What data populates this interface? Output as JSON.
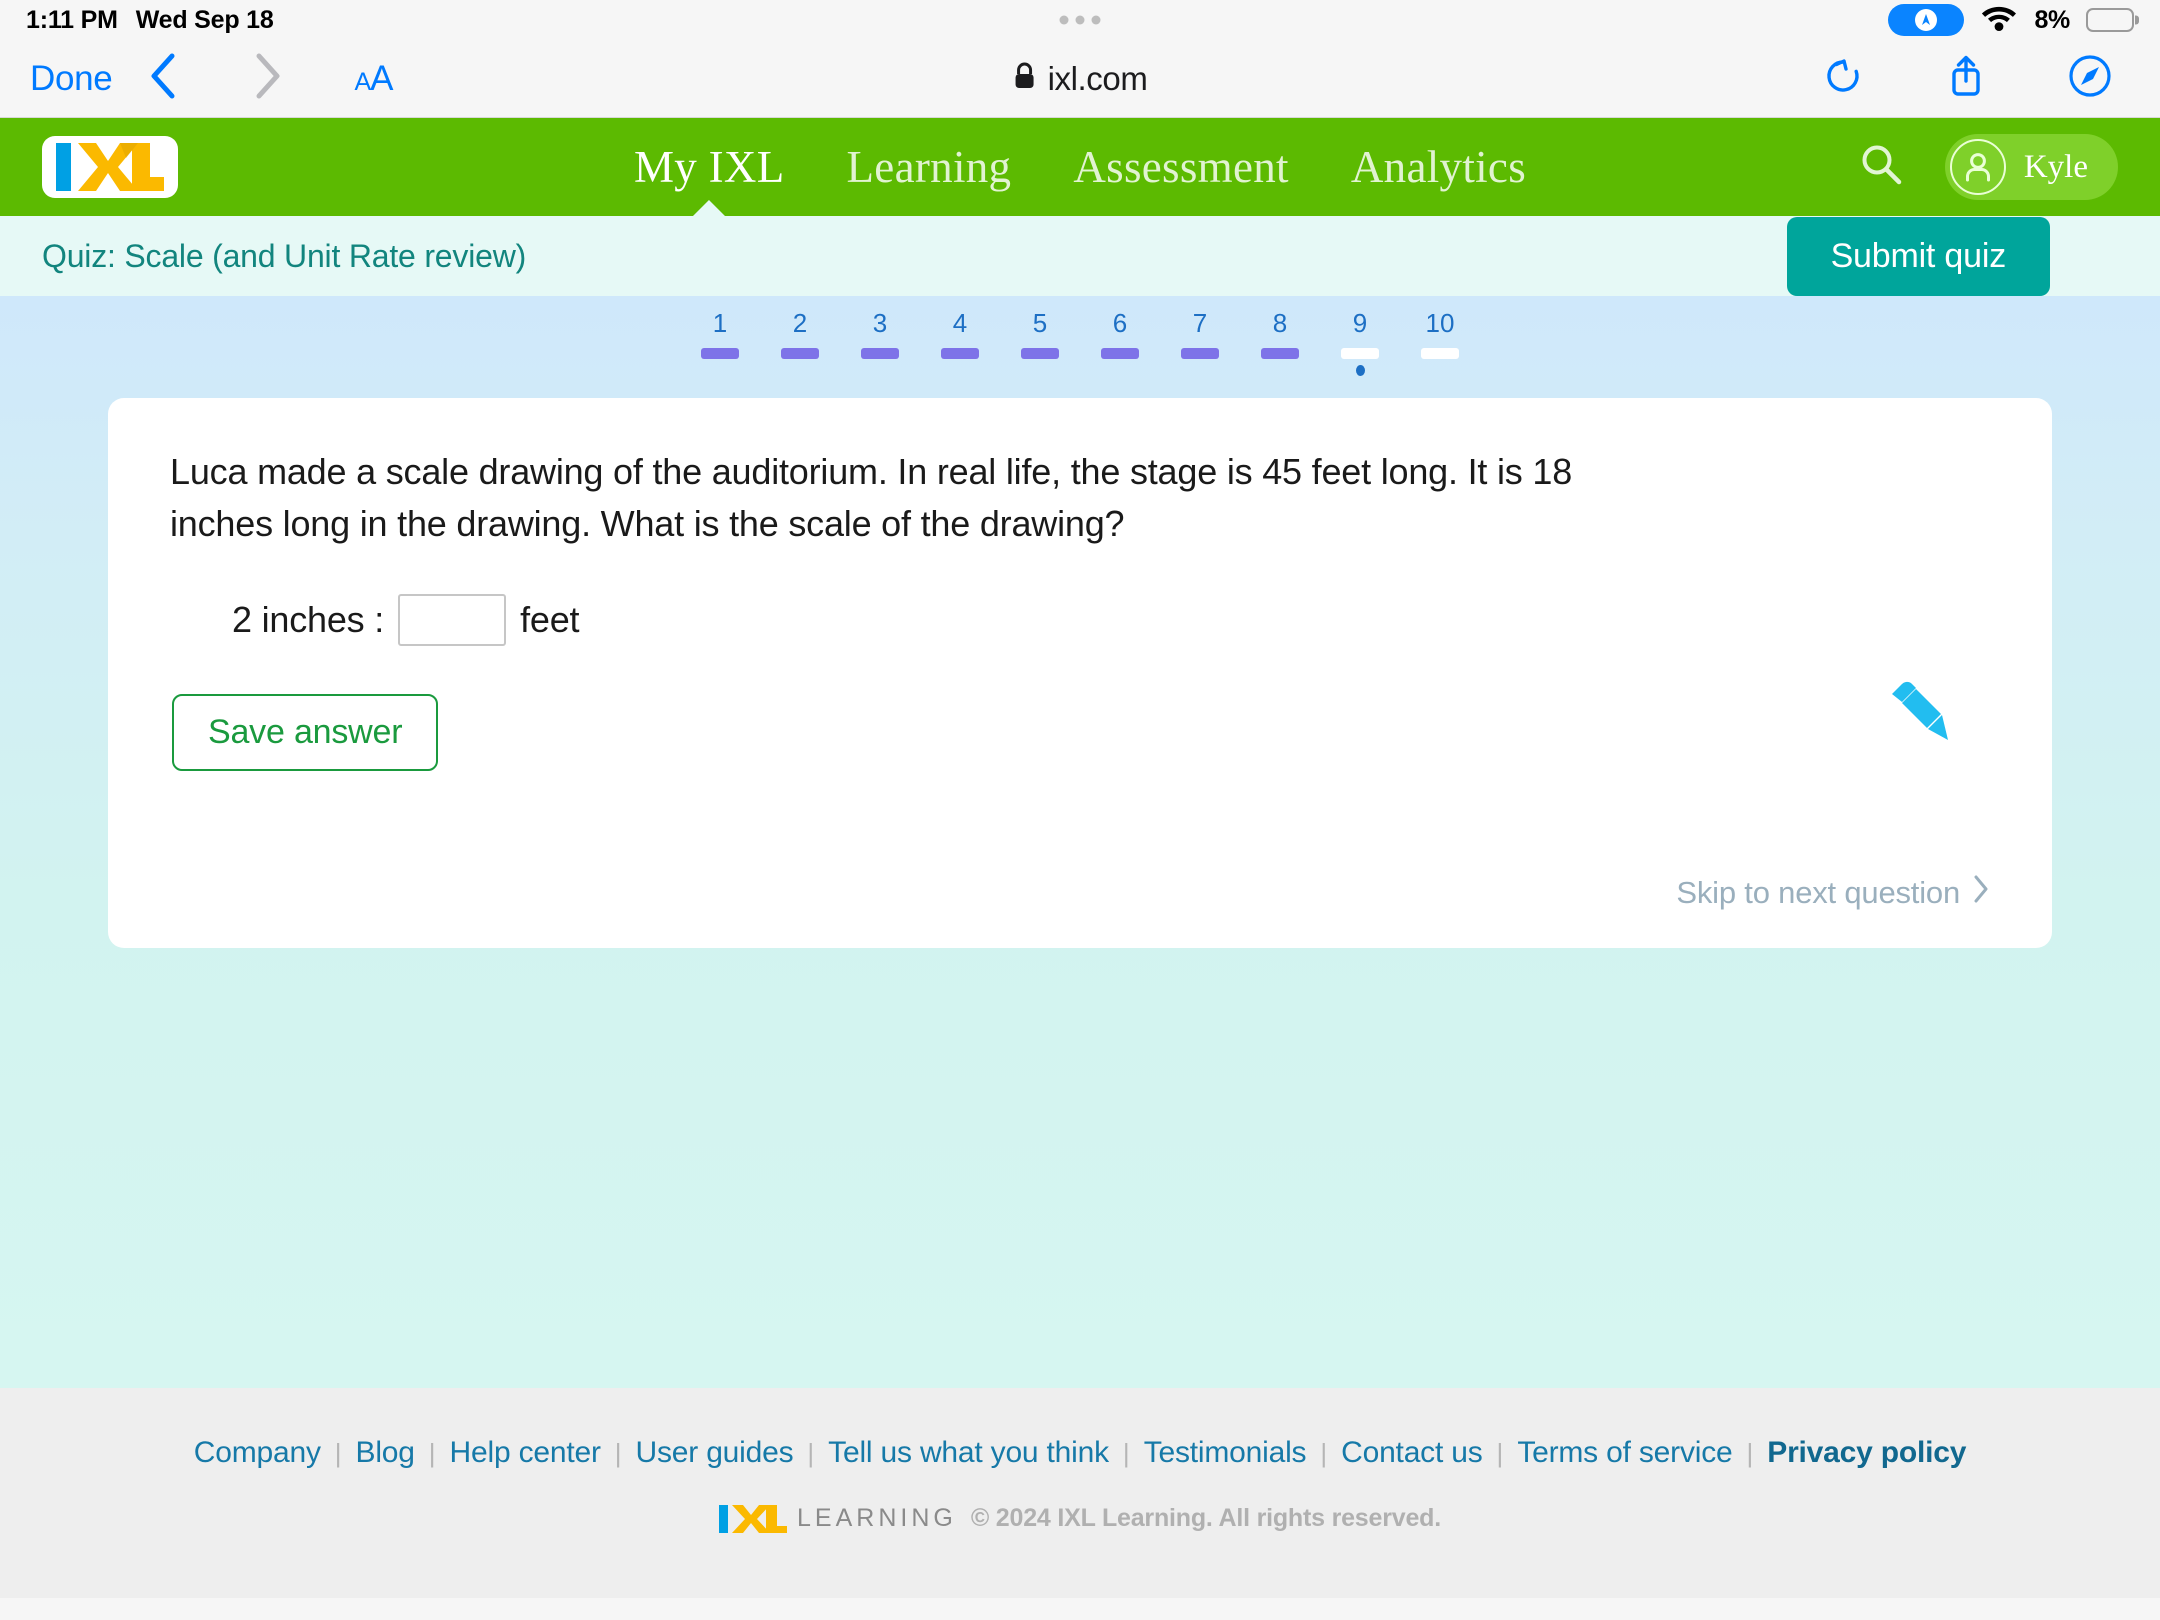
{
  "statusbar": {
    "time": "1:11 PM",
    "date": "Wed Sep 18",
    "battery_percent": "8%",
    "location_icon": "location-arrow-icon",
    "wifi_icon": "wifi-icon",
    "battery_icon": "battery-icon",
    "battery_fill_color": "#ff3b30"
  },
  "toolbar": {
    "done_label": "Done",
    "back_icon": "chevron-left-icon",
    "forward_icon": "chevron-right-icon",
    "text_size_small": "A",
    "text_size_big": "A",
    "lock_icon": "lock-icon",
    "url": "ixl.com",
    "reload_icon": "reload-icon",
    "share_icon": "share-icon",
    "compass_icon": "safari-compass-icon"
  },
  "ixl_nav": {
    "logo_text": "IXL",
    "links": [
      {
        "label": "My IXL",
        "active": true
      },
      {
        "label": "Learning",
        "active": false
      },
      {
        "label": "Assessment",
        "active": false
      },
      {
        "label": "Analytics",
        "active": false
      }
    ],
    "search_icon": "search-icon",
    "avatar_icon": "user-avatar-icon",
    "user_name": "Kyle",
    "brand_green": "#5cba01"
  },
  "quiz_bar": {
    "title": "Quiz: Scale (and Unit Rate review)",
    "submit_label": "Submit quiz",
    "submit_color": "#00a59b",
    "bar_bg": "#e6f9f6"
  },
  "pager": {
    "items": [
      {
        "num": "1",
        "state": "answered",
        "current": false
      },
      {
        "num": "2",
        "state": "answered",
        "current": false
      },
      {
        "num": "3",
        "state": "answered",
        "current": false
      },
      {
        "num": "4",
        "state": "answered",
        "current": false
      },
      {
        "num": "5",
        "state": "answered",
        "current": false
      },
      {
        "num": "6",
        "state": "answered",
        "current": false
      },
      {
        "num": "7",
        "state": "answered",
        "current": false
      },
      {
        "num": "8",
        "state": "answered",
        "current": false
      },
      {
        "num": "9",
        "state": "unanswered",
        "current": true
      },
      {
        "num": "10",
        "state": "unanswered",
        "current": false
      }
    ],
    "answered_color": "#7d73e8",
    "unanswered_color": "#ffffff",
    "number_color": "#1d6fc4"
  },
  "question": {
    "text": "Luca made a scale drawing of the auditorium. In real life, the stage is 45 feet long. It is 18 inches long in the drawing. What is the scale of the drawing?",
    "answer_prefix": "2 inches :",
    "answer_value": "",
    "answer_placeholder": "",
    "answer_suffix": "feet",
    "save_label": "Save answer",
    "pencil_icon": "pencil-icon",
    "pencil_color": "#22bdf0",
    "skip_label": "Skip to next question",
    "skip_chevron_icon": "chevron-right-icon"
  },
  "footer": {
    "links": [
      {
        "label": "Company",
        "bold": false
      },
      {
        "label": "Blog",
        "bold": false
      },
      {
        "label": "Help center",
        "bold": false
      },
      {
        "label": "User guides",
        "bold": false
      },
      {
        "label": "Tell us what you think",
        "bold": false
      },
      {
        "label": "Testimonials",
        "bold": false
      },
      {
        "label": "Contact us",
        "bold": false
      },
      {
        "label": "Terms of service",
        "bold": false
      },
      {
        "label": "Privacy policy",
        "bold": true
      }
    ],
    "separator": "|",
    "logo_text": "IXL",
    "learning_word": "LEARNING",
    "copyright": "© 2024 IXL Learning. All rights reserved."
  }
}
